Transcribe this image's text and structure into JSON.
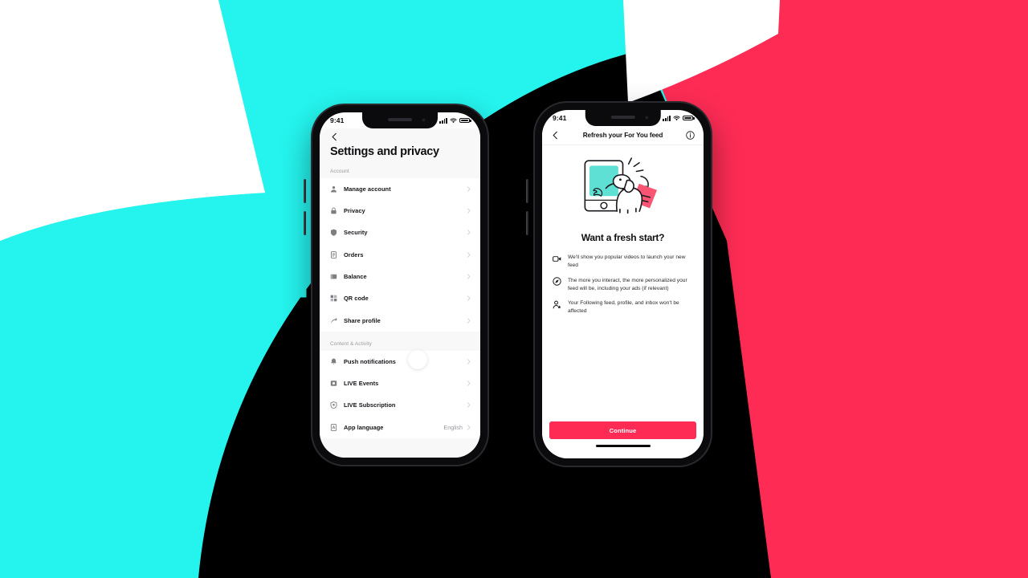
{
  "background": {
    "colors": {
      "cyan": "#25F4EE",
      "red": "#FE2C55",
      "black": "#000000",
      "white": "#FFFFFF"
    }
  },
  "phone_left": {
    "status_bar": {
      "time": "9:41",
      "signal_icon": "cellular-signal-icon",
      "wifi_icon": "wifi-icon",
      "battery_icon": "battery-icon"
    },
    "back_icon": "chevron-left-icon",
    "title": "Settings and privacy",
    "sections": [
      {
        "heading": "Account",
        "items": [
          {
            "label": "Manage account",
            "icon": "person-icon",
            "value": ""
          },
          {
            "label": "Privacy",
            "icon": "lock-icon",
            "value": ""
          },
          {
            "label": "Security",
            "icon": "shield-icon",
            "value": ""
          },
          {
            "label": "Orders",
            "icon": "receipt-icon",
            "value": ""
          },
          {
            "label": "Balance",
            "icon": "wallet-icon",
            "value": ""
          },
          {
            "label": "QR code",
            "icon": "qr-code-icon",
            "value": ""
          },
          {
            "label": "Share profile",
            "icon": "share-arrow-icon",
            "value": ""
          }
        ]
      },
      {
        "heading": "Content & Activity",
        "items": [
          {
            "label": "Push notifications",
            "icon": "bell-icon",
            "value": ""
          },
          {
            "label": "LIVE Events",
            "icon": "live-events-icon",
            "value": ""
          },
          {
            "label": "LIVE Subscription",
            "icon": "live-subscription-icon",
            "value": ""
          },
          {
            "label": "App language",
            "icon": "language-icon",
            "value": "English"
          }
        ]
      }
    ],
    "cursor": "tap-indicator"
  },
  "phone_right": {
    "status_bar": {
      "time": "9:41",
      "signal_icon": "cellular-signal-icon",
      "wifi_icon": "wifi-icon",
      "battery_icon": "battery-icon"
    },
    "nav": {
      "back_icon": "chevron-left-icon",
      "title": "Refresh your For You feed",
      "info_icon": "info-circle-icon"
    },
    "illustration": "dog-cleaning-phone-illustration",
    "heading": "Want a fresh start?",
    "bullets": [
      {
        "icon": "video-camera-icon",
        "text": "We'll show you popular videos to launch your new feed"
      },
      {
        "icon": "compass-target-icon",
        "text": "The more you interact, the more personalized your feed will be, including your ads (if relevant)"
      },
      {
        "icon": "person-star-icon",
        "text": "Your Following feed, profile, and inbox won't be affected"
      }
    ],
    "continue_label": "Continue",
    "home_indicator": "home-indicator"
  }
}
